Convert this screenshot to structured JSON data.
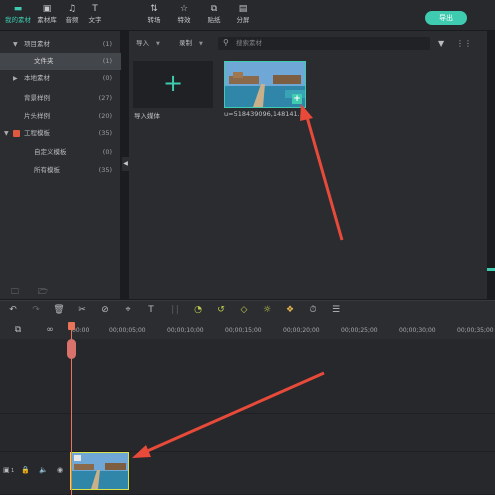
{
  "top_tabs": [
    {
      "label": "我的素材",
      "icon": "folder-icon",
      "active": true
    },
    {
      "label": "素材库",
      "icon": "media-library-icon"
    },
    {
      "label": "音频",
      "icon": "music-note-icon"
    },
    {
      "label": "文字",
      "icon": "text-t-icon"
    },
    {
      "label": "转场",
      "icon": "transition-icon"
    },
    {
      "label": "特效",
      "icon": "effects-star-icon"
    },
    {
      "label": "贴纸",
      "icon": "sticker-icon"
    },
    {
      "label": "分屏",
      "icon": "split-screen-icon"
    }
  ],
  "export_label": "导出",
  "sidebar": {
    "items": [
      {
        "label": "项目素材",
        "count": "(1)",
        "expanded": true
      },
      {
        "label": "文件夹",
        "count": "(1)",
        "selected": true
      },
      {
        "label": "本地素材",
        "count": "(0)",
        "expanded": false
      },
      {
        "label": "背景样例",
        "count": "(27)"
      },
      {
        "label": "片头样例",
        "count": "(20)"
      },
      {
        "label": "工程模板",
        "count": "(35)",
        "expanded": true
      },
      {
        "label": "自定义模板",
        "count": "(0)"
      },
      {
        "label": "所有模板",
        "count": "(35)"
      }
    ]
  },
  "media_toolbar": {
    "import_dropdown": "导入",
    "record_dropdown": "录制",
    "search_placeholder": "搜索素材"
  },
  "media_items": {
    "import_label": "导入媒体",
    "clip_label": "u=518439096,148141..."
  },
  "ruler_ticks": [
    "00:00",
    "00;00;05;00",
    "00;00;10;00",
    "00;00;15;00",
    "00;00;20;00",
    "00;00;25;00",
    "00;00;30;00",
    "00;00;35;00"
  ],
  "track_header": {
    "track_number": "1"
  },
  "colors": {
    "accent": "#3ecbb0",
    "playhead": "#e8755a",
    "timeline_clip_border": "#d8e04a",
    "annotation_arrow": "#e84a3a"
  }
}
